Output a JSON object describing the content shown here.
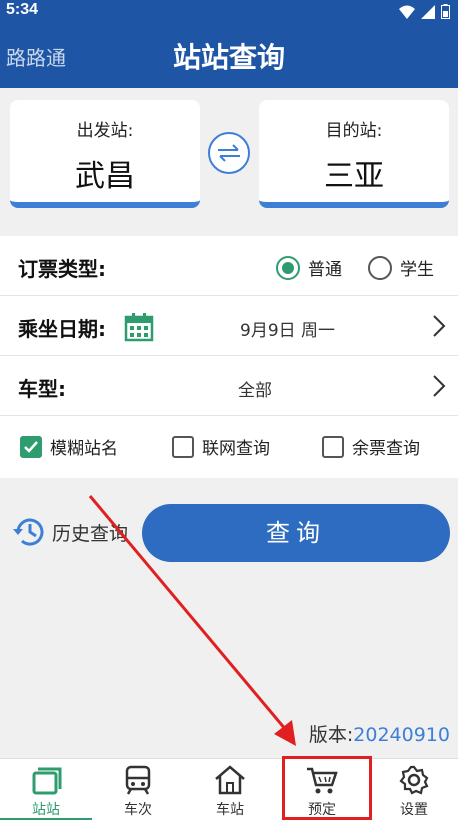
{
  "status_bar": {
    "time": "5:34"
  },
  "app_bar": {
    "app_name": "路路通",
    "title": "站站查询"
  },
  "stations": {
    "from_label": "出发站:",
    "from_name": "武昌",
    "to_label": "目的站:",
    "to_name": "三亚"
  },
  "form": {
    "ticket_type_label": "订票类型:",
    "ticket_options": [
      {
        "label": "普通",
        "selected": true
      },
      {
        "label": "学生",
        "selected": false
      }
    ],
    "date_label": "乘坐日期:",
    "date_value": "9月9日 周一",
    "train_type_label": "车型:",
    "train_type_value": "全部",
    "checkboxes": [
      {
        "label": "模糊站名",
        "checked": true
      },
      {
        "label": "联网查询",
        "checked": false
      },
      {
        "label": "余票查询",
        "checked": false
      }
    ]
  },
  "actions": {
    "history_label": "历史查询",
    "query_label": "查询"
  },
  "version": {
    "label": "版本:",
    "value": "20240910"
  },
  "bottom_nav": [
    {
      "label": "站站",
      "icon": "station-to-station-icon",
      "active": true
    },
    {
      "label": "车次",
      "icon": "train-icon",
      "active": false
    },
    {
      "label": "车站",
      "icon": "home-station-icon",
      "active": false
    },
    {
      "label": "预定",
      "icon": "cart-icon",
      "active": false
    },
    {
      "label": "设置",
      "icon": "gear-icon",
      "active": false
    }
  ],
  "colors": {
    "primary": "#1e55a4",
    "accent": "#2e9c6e",
    "link": "#3d7fd6",
    "highlight": "#e02020"
  }
}
